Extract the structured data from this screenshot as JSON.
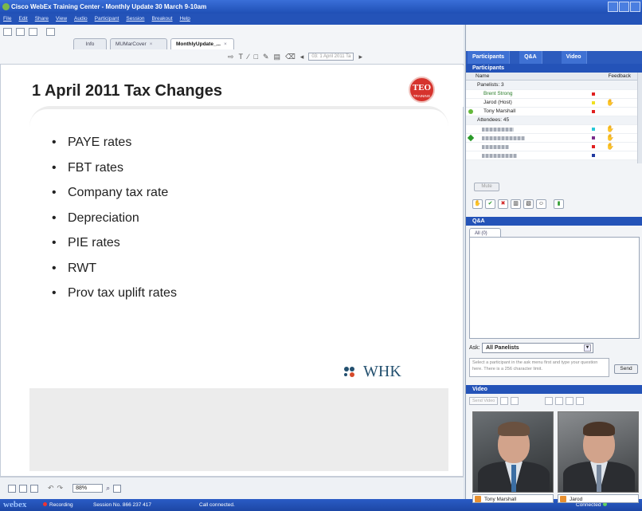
{
  "window": {
    "title": "Cisco WebEx Training Center - Monthly Update 30 March 9-10am"
  },
  "menu": [
    "File",
    "Edit",
    "Share",
    "View",
    "Audio",
    "Participant",
    "Session",
    "Breakout",
    "Help"
  ],
  "doc_tabs": [
    {
      "label": "Info",
      "active": false
    },
    {
      "label": "MUMarCover",
      "active": false
    },
    {
      "label": "MonthlyUpdate_...",
      "active": true
    }
  ],
  "annotation": {
    "page_selector": "03: 1 April 2011 Ta"
  },
  "slide": {
    "title": "1 April 2011 Tax Changes",
    "logo_top": "TEO",
    "logo_bottom": "TRAINING",
    "bullets": [
      "PAYE rates",
      "FBT rates",
      "Company tax rate",
      "Depreciation",
      "PIE rates",
      "RWT",
      "Prov tax uplift rates"
    ],
    "brand": "WHK"
  },
  "zoom": "88%",
  "statusbar": {
    "brand": "webex",
    "recording": "Recording",
    "session": "Session No. 866 237 417",
    "connection": "Call connected.",
    "connected": "Connected"
  },
  "panel": {
    "tabs": [
      "Participants",
      "Q&A",
      "Video"
    ],
    "participants_header": "Participants",
    "columns": {
      "name": "Name",
      "feedback": "Feedback"
    },
    "panelists_label": "Panelists: 3",
    "panelists": [
      {
        "name": "Brent Strong",
        "color": "#e02020"
      },
      {
        "name": "Jarod (Host)",
        "color": "#f0e020",
        "hand": true
      },
      {
        "name": "Tony Marshall",
        "color": "#e02020"
      }
    ],
    "attendees_label": "Attendees: 45",
    "attendee_colors": [
      "#28c8d8",
      "#7a2a8a",
      "#e02020",
      "#203aa0"
    ],
    "mute_label": "Mute",
    "qa_header": "Q&A",
    "qa_tab": "All (0)",
    "ask_label": "Ask:",
    "ask_value": "All Panelists",
    "qa_placeholder": "Select a participant in the ask menu first and type your question here. There is a 256 character limit.",
    "send_label": "Send",
    "video_header": "Video",
    "send_video_label": "Send Video",
    "video_names": [
      "Tony Marshall",
      "Jarod"
    ]
  }
}
